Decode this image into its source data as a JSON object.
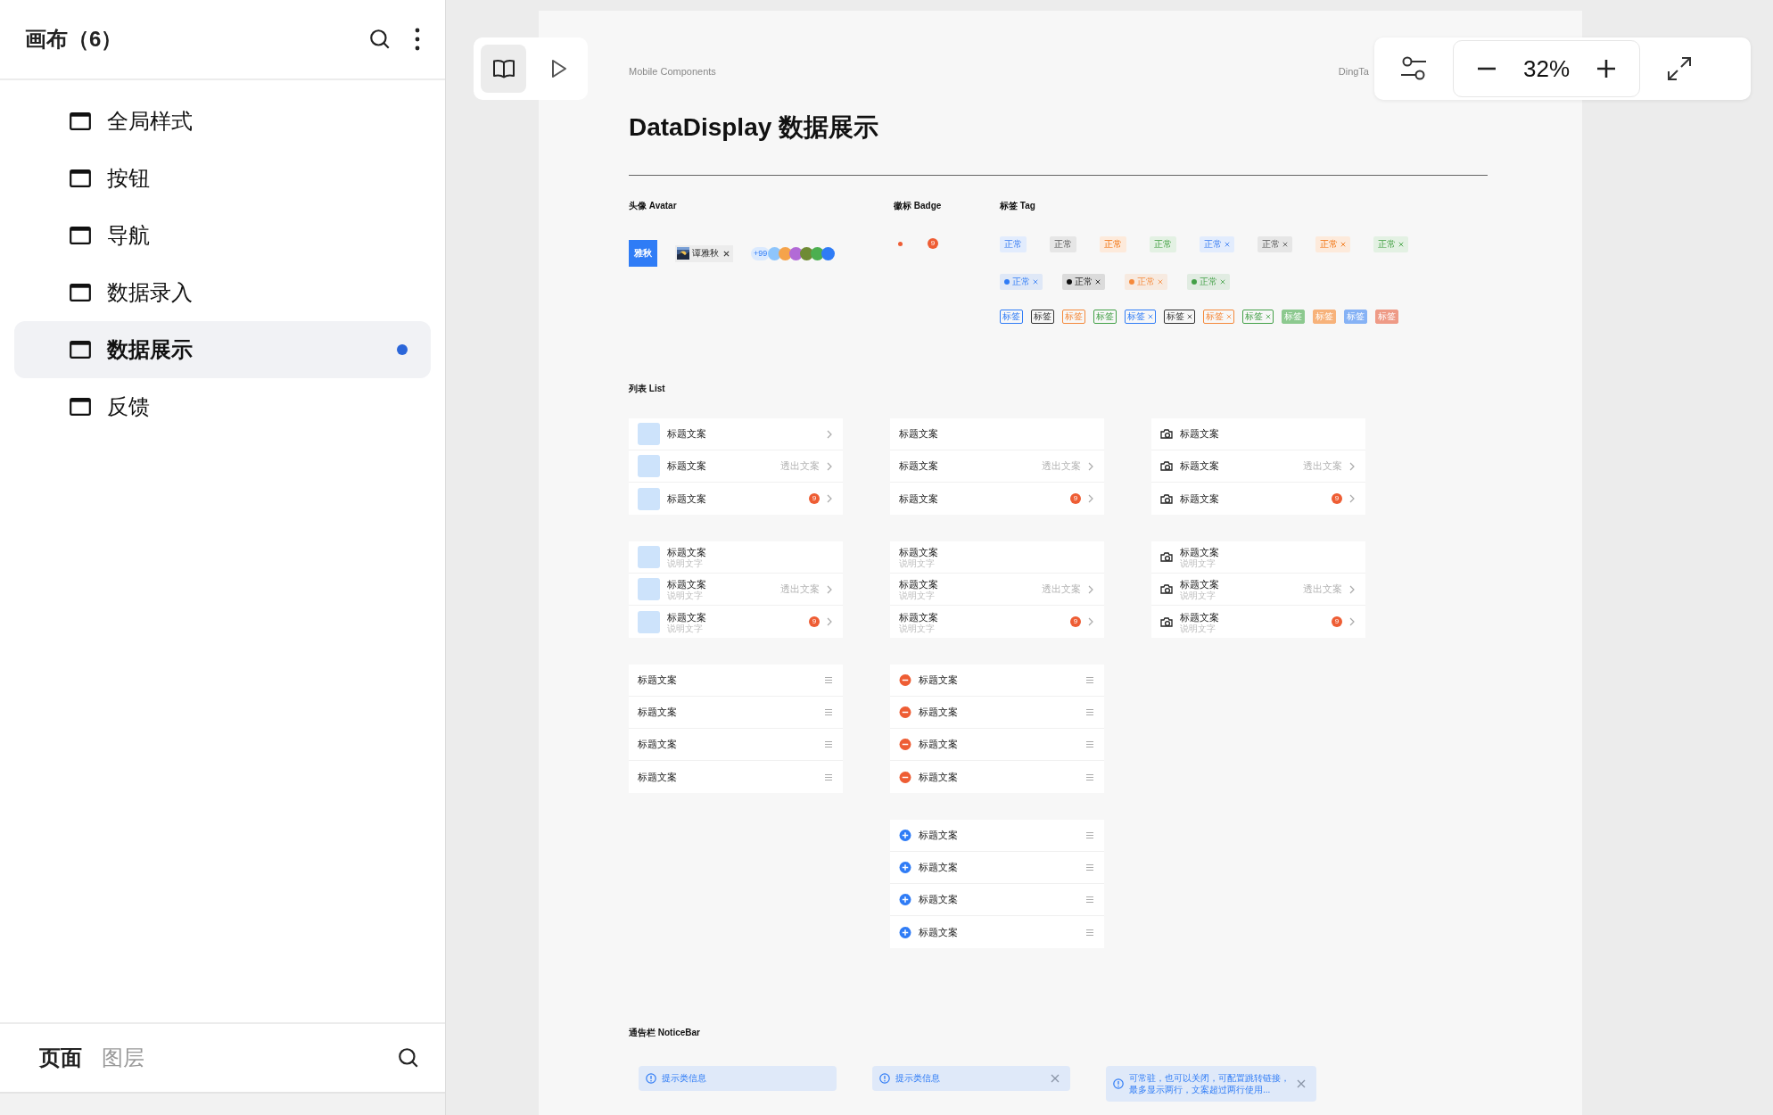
{
  "sidebar": {
    "title": "画布（6）",
    "items": [
      {
        "label": "全局样式",
        "selected": false,
        "modified": false
      },
      {
        "label": "按钮",
        "selected": false,
        "modified": false
      },
      {
        "label": "导航",
        "selected": false,
        "modified": false
      },
      {
        "label": "数据录入",
        "selected": false,
        "modified": false
      },
      {
        "label": "数据展示",
        "selected": true,
        "modified": true
      },
      {
        "label": "反馈",
        "selected": false,
        "modified": false
      }
    ]
  },
  "bottom_tabs": [
    {
      "label": "页面",
      "selected": true
    },
    {
      "label": "图层",
      "selected": false
    }
  ],
  "canvas_tools": [
    {
      "kind": "book",
      "selected": true
    },
    {
      "kind": "play",
      "selected": false
    }
  ],
  "zoom": {
    "value": "32%"
  },
  "artboard": {
    "label": "Mobile Components",
    "brand": "DingTa",
    "title": "DataDisplay 数据展示",
    "avatar": {
      "heading": "头像 Avatar",
      "square": "雅秋",
      "chip": "谭雅秋",
      "group_count": "+99",
      "group": [
        {
          "color": "#8ec5fb"
        },
        {
          "color": "#f5a34a"
        },
        {
          "color": "#b26ad6"
        },
        {
          "color": "#6f8b35"
        },
        {
          "color": "#4caf50"
        },
        {
          "color": "#2f7cf6"
        }
      ]
    },
    "badge": {
      "heading": "徽标 Badge",
      "count": "9"
    },
    "tags": {
      "heading": "标签 Tag",
      "plain_tags": [
        {
          "label": "正常",
          "color": "#e2ecfd",
          "closable": false
        },
        {
          "label": "正常",
          "color": "#e6e6e6",
          "closable": false
        },
        {
          "label": "正常",
          "color": "#fdeadb",
          "closable": false
        },
        {
          "label": "正常",
          "color": "#e3f1e3",
          "closable": false
        },
        {
          "label": "正常",
          "color": "#e2ecfd",
          "closable": true
        },
        {
          "label": "正常",
          "color": "#e6e6e6",
          "closable": true
        },
        {
          "label": "正常",
          "color": "#fdeadb",
          "closable": true
        },
        {
          "label": "正常",
          "color": "#e3f1e3",
          "closable": true
        }
      ],
      "dot_tags": [
        {
          "label": "正常",
          "color": "#2f7cf6",
          "closable": true
        },
        {
          "label": "正常",
          "color": "#111111",
          "closable": true
        },
        {
          "label": "正常",
          "color": "#f5893a",
          "closable": true
        },
        {
          "label": "正常",
          "color": "#43a047",
          "closable": true
        }
      ],
      "small_tags": [
        {
          "label": "标签",
          "kind": "outline",
          "color": "#2f7cf6",
          "closable": false
        },
        {
          "label": "标签",
          "kind": "outline",
          "color": "#333333",
          "closable": false
        },
        {
          "label": "标签",
          "kind": "outline",
          "color": "#f5893a",
          "closable": false
        },
        {
          "label": "标签",
          "kind": "outline",
          "color": "#43a047",
          "closable": false
        },
        {
          "label": "标签",
          "kind": "outline",
          "color": "#2f7cf6",
          "closable": true
        },
        {
          "label": "标签",
          "kind": "outline",
          "color": "#333333",
          "closable": true
        },
        {
          "label": "标签",
          "kind": "outline",
          "color": "#f5893a",
          "closable": true
        },
        {
          "label": "标签",
          "kind": "outline",
          "color": "#43a047",
          "closable": true
        },
        {
          "label": "标签",
          "kind": "solid",
          "color": "#8cc98f",
          "closable": false
        },
        {
          "label": "标签",
          "kind": "solid",
          "color": "#f7b27a",
          "closable": false
        },
        {
          "label": "标签",
          "kind": "solid",
          "color": "#86b2f5",
          "closable": false
        },
        {
          "label": "标签",
          "kind": "solid",
          "color": "#ee9a86",
          "closable": false
        }
      ]
    },
    "lists": {
      "heading": "列表 List",
      "columns": [
        [
          {
            "kind": "thumb",
            "rows": [
              {
                "title": "标题文案",
                "arrow": true
              },
              {
                "title": "标题文案",
                "extra": "透出文案",
                "arrow": true
              },
              {
                "title": "标题文案",
                "badge": "9",
                "arrow": true
              }
            ]
          },
          {
            "kind": "thumb",
            "rows": [
              {
                "title": "标题文案",
                "description": "说明文字",
                "arrow": false
              },
              {
                "title": "标题文案",
                "description": "说明文字",
                "extra": "透出文案",
                "arrow": true
              },
              {
                "title": "标题文案",
                "description": "说明文字",
                "badge": "9",
                "arrow": true
              }
            ]
          },
          {
            "kind": "drag",
            "rows": [
              {
                "title": "标题文案",
                "arrow": false
              },
              {
                "title": "标题文案",
                "arrow": false
              },
              {
                "title": "标题文案",
                "arrow": false
              },
              {
                "title": "标题文案",
                "arrow": false
              }
            ]
          }
        ],
        [
          {
            "kind": "plain",
            "rows": [
              {
                "title": "标题文案",
                "arrow": false
              },
              {
                "title": "标题文案",
                "extra": "透出文案",
                "arrow": true
              },
              {
                "title": "标题文案",
                "badge": "9",
                "arrow": true
              }
            ]
          },
          {
            "kind": "plain",
            "rows": [
              {
                "title": "标题文案",
                "description": "说明文字",
                "arrow": false
              },
              {
                "title": "标题文案",
                "description": "说明文字",
                "extra": "透出文案",
                "arrow": true
              },
              {
                "title": "标题文案",
                "description": "说明文字",
                "badge": "9",
                "arrow": true
              }
            ]
          },
          {
            "kind": "remove",
            "rows": [
              {
                "title": "标题文案",
                "arrow": false
              },
              {
                "title": "标题文案",
                "arrow": false
              },
              {
                "title": "标题文案",
                "arrow": false
              },
              {
                "title": "标题文案",
                "arrow": false
              }
            ]
          },
          {
            "kind": "add",
            "rows": [
              {
                "title": "标题文案",
                "arrow": false
              },
              {
                "title": "标题文案",
                "arrow": false
              },
              {
                "title": "标题文案",
                "arrow": false
              },
              {
                "title": "标题文案",
                "arrow": false
              }
            ]
          }
        ],
        [
          {
            "kind": "icon",
            "rows": [
              {
                "title": "标题文案",
                "arrow": false
              },
              {
                "title": "标题文案",
                "extra": "透出文案",
                "arrow": true
              },
              {
                "title": "标题文案",
                "badge": "9",
                "arrow": true
              }
            ]
          },
          {
            "kind": "icon",
            "rows": [
              {
                "title": "标题文案",
                "description": "说明文字",
                "arrow": false
              },
              {
                "title": "标题文案",
                "description": "说明文字",
                "extra": "透出文案",
                "arrow": true
              },
              {
                "title": "标题文案",
                "description": "说明文字",
                "badge": "9",
                "arrow": true
              }
            ]
          }
        ]
      ]
    },
    "noticebar": {
      "heading": "通告栏 NoticeBar",
      "bars": [
        {
          "text": "提示类信息",
          "closable": false
        },
        {
          "text": "提示类信息",
          "closable": true
        },
        {
          "text": "可常驻，也可以关闭，可配置跳转链接，最多显示两行，文案超过两行使用...",
          "closable": true
        }
      ]
    }
  }
}
